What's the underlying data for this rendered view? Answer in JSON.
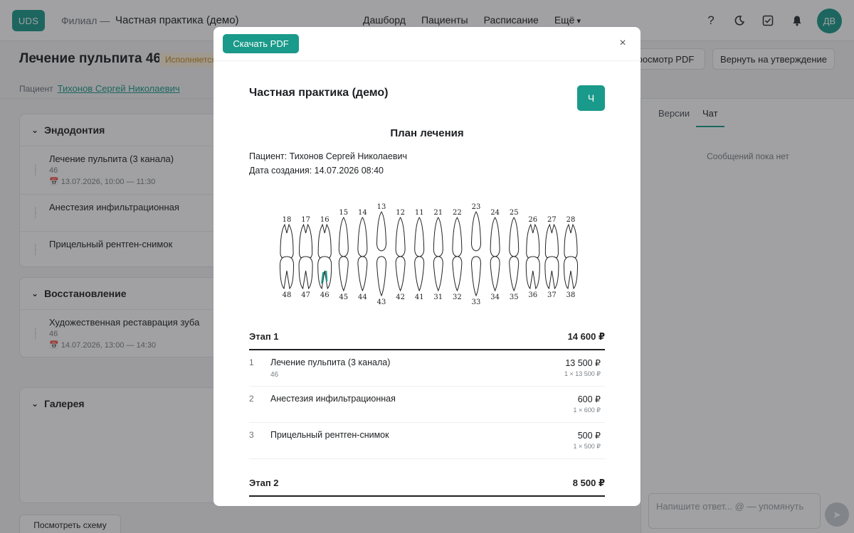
{
  "topbar": {
    "logo": "UDS",
    "branch_prefix": "Филиал —",
    "branch_name": "Частная практика (демо)",
    "nav": [
      "Дашборд",
      "Пациенты",
      "Расписание",
      "Ещё"
    ],
    "avatar_initials": "ДВ"
  },
  "page": {
    "title": "Лечение пульпита 46",
    "status": "Исполняется",
    "btn_preview_pdf": "росмотр PDF",
    "btn_return": "Вернуть на утверждение",
    "patient_label": "Пациент",
    "patient_name": "Тихонов Сергей Николаевич"
  },
  "sections": [
    {
      "title": "Эндодонтия",
      "services": [
        {
          "name": "Лечение пульпита (3 канала)",
          "tooth": "46",
          "date": "13.07.2026, 10:00 — 11:30"
        },
        {
          "name": "Анестезия инфильтрационная"
        },
        {
          "name": "Прицельный рентген-снимок"
        }
      ]
    },
    {
      "title": "Восстановление",
      "services": [
        {
          "name": "Художественная реставрация зуба",
          "tooth": "46",
          "date": "14.07.2026, 13:00 — 14:30"
        }
      ]
    }
  ],
  "gallery_title": "Галерея",
  "schema_button": "Посмотреть схему",
  "right_panel": {
    "tabs": [
      "Версии",
      "Чат"
    ],
    "no_messages": "Сообщений пока нет",
    "chat_placeholder": "Напишите ответ... @ — упомянуть"
  },
  "modal": {
    "download_pdf": "Скачать PDF",
    "clinic_name": "Частная практика (демо)",
    "clinic_logo_letter": "Ч",
    "doc_title": "План лечения",
    "patient_line": "Пациент: Тихонов Сергей Николаевич",
    "created_line": "Дата создания: 14.07.2026 08:40",
    "dental_chart": {
      "upper": [
        "18",
        "17",
        "16",
        "15",
        "14",
        "13",
        "12",
        "11",
        "21",
        "22",
        "23",
        "24",
        "25",
        "26",
        "27",
        "28"
      ],
      "lower": [
        "48",
        "47",
        "46",
        "45",
        "44",
        "43",
        "42",
        "41",
        "31",
        "32",
        "33",
        "34",
        "35",
        "36",
        "37",
        "38"
      ],
      "highlighted_tooth": "46",
      "highlight_color": "#1a9a8a"
    },
    "stages": [
      {
        "name": "Этап 1",
        "total": "14 600 ₽",
        "items": [
          {
            "num": "1",
            "name": "Лечение пульпита (3 канала)",
            "tooth": "46",
            "price": "13 500 ₽",
            "calc": "1 × 13 500 ₽"
          },
          {
            "num": "2",
            "name": "Анестезия инфильтрационная",
            "price": "600 ₽",
            "calc": "1 × 600 ₽"
          },
          {
            "num": "3",
            "name": "Прицельный рентген-снимок",
            "price": "500 ₽",
            "calc": "1 × 500 ₽"
          }
        ]
      },
      {
        "name": "Этап 2",
        "total": "8 500 ₽",
        "items": []
      }
    ]
  }
}
